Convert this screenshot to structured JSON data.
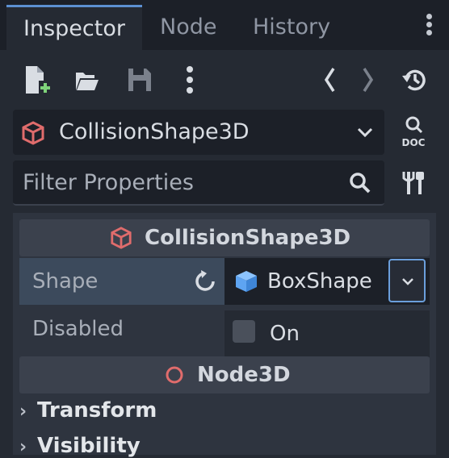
{
  "tabs": [
    "Inspector",
    "Node",
    "History"
  ],
  "toolbar": {
    "new_resource_icon": "new-resource-icon",
    "open_icon": "folder-open-icon",
    "save_icon": "save-icon",
    "more_icon": "kebab-menu-icon",
    "back_icon": "chevron-left-icon",
    "forward_icon": "chevron-right-icon",
    "history_icon": "history-icon"
  },
  "object_selector": {
    "label": "CollisionShape3D",
    "doc_label": "DOC"
  },
  "filter": {
    "placeholder": "Filter Properties"
  },
  "sections": {
    "collision": "CollisionShape3D",
    "node3d": "Node3D"
  },
  "properties": {
    "shape": {
      "label": "Shape",
      "value": "BoxShape"
    },
    "disabled": {
      "label": "Disabled",
      "value": "On"
    }
  },
  "groups": [
    "Transform",
    "Visibility"
  ],
  "colors": {
    "accent": "#6b9fdc",
    "collision_icon": "#e06c6c",
    "box_icon": "#5ea4f2"
  }
}
